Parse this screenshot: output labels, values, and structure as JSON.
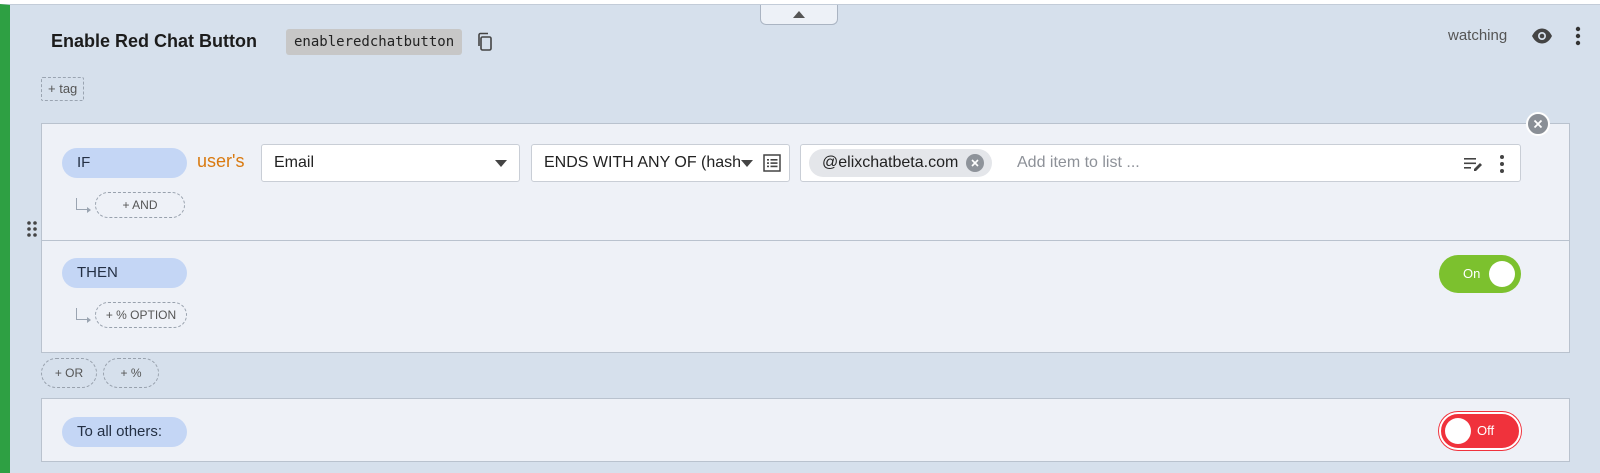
{
  "flag": {
    "title": "Enable Red Chat Button",
    "key": "enableredchatbutton",
    "watch_label": "watching",
    "tag_button": "+ tag",
    "accent_color": "#2ea043"
  },
  "rule": {
    "if_label": "IF",
    "subject": "user's",
    "attribute": "Email",
    "operator": "ENDS WITH ANY OF (hash",
    "values": [
      "@elixchatbeta.com"
    ],
    "add_item_placeholder": "Add item to list ...",
    "and_button": "+ AND",
    "then_label": "THEN",
    "then_toggle": "On",
    "option_button": "+ % OPTION"
  },
  "actions": {
    "or_button": "+ OR",
    "percent_button": "+ %"
  },
  "others": {
    "label": "To all others:",
    "toggle": "Off"
  },
  "colors": {
    "on": "#7cc12e",
    "off": "#f0323c",
    "subject": "#d97a10"
  }
}
